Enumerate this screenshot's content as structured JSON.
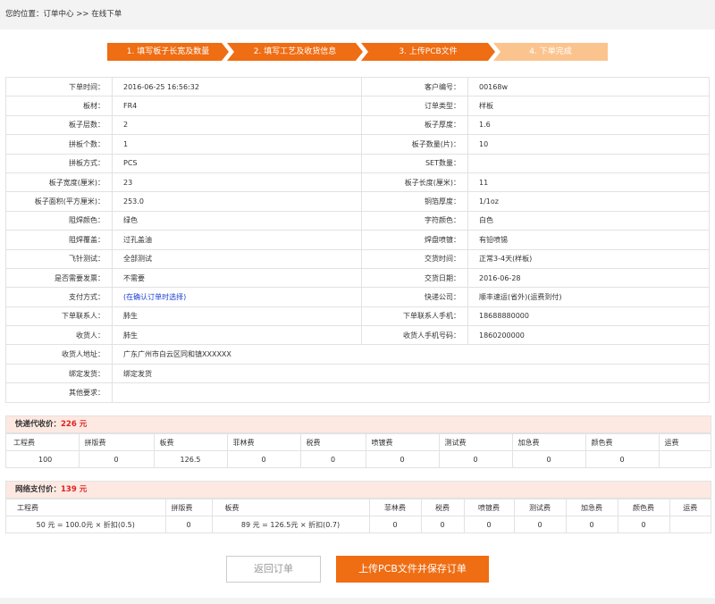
{
  "breadcrumb": {
    "prefix": "您的位置：",
    "items": [
      "订单中心",
      ">>",
      "在线下单"
    ]
  },
  "steps": [
    "1. 填写板子长宽及数量",
    "2. 填写工艺及收货信息",
    "3. 上传PCB文件",
    "4. 下单完成"
  ],
  "colors": {
    "accent": "#ef6d13",
    "accent_light": "#fbc48f",
    "price_red": "#e02020",
    "link_blue": "#1a3fd4"
  },
  "info": {
    "order_time_label": "下单时间：",
    "order_time": "2016-06-25 16:56:32",
    "customer_no_label": "客户编号：",
    "customer_no": "00168w",
    "material_label": "板材：",
    "material": "FR4",
    "order_type_label": "订单类型：",
    "order_type": "样板",
    "layers_label": "板子层数：",
    "layers": "2",
    "thickness_label": "板子厚度：",
    "thickness": "1.6",
    "panel_count_label": "拼板个数：",
    "panel_count": "1",
    "qty_label": "板子数量(片)：",
    "qty": "10",
    "panel_mode_label": "拼板方式：",
    "panel_mode": "PCS",
    "set_qty_label": "SET数量：",
    "set_qty": "",
    "width_label": "板子宽度(厘米)：",
    "width": "23",
    "length_label": "板子长度(厘米)：",
    "length": "11",
    "area_label": "板子面积(平方厘米)：",
    "area": "253.0",
    "copper_label": "铜箔厚度：",
    "copper": "1/1oz",
    "mask_color_label": "阻焊颜色：",
    "mask_color": "绿色",
    "silk_color_label": "字符颜色：",
    "silk_color": "白色",
    "mask_cover_label": "阻焊覆盖：",
    "mask_cover": "过孔盖油",
    "surface_label": "焊盘喷镀：",
    "surface": "有铅喷锡",
    "flying_label": "飞针测试：",
    "flying": "全部测试",
    "delivery_time_label": "交货时间：",
    "delivery_time": "正常3-4天(样板)",
    "invoice_label": "是否需要发票：",
    "invoice": "不需要",
    "delivery_date_label": "交货日期：",
    "delivery_date": "2016-06-28",
    "pay_label": "支付方式：",
    "pay": "(在确认订单时选择)",
    "courier_label": "快递公司：",
    "courier": "顺丰速运(省外)(运费到付)",
    "contact_label": "下单联系人：",
    "contact": "肺生",
    "contact_phone_label": "下单联系人手机：",
    "contact_phone": "18688880000",
    "receiver_label": "收货人：",
    "receiver": "肺生",
    "receiver_phone_label": "收货人手机号码：",
    "receiver_phone": "1860200000",
    "address_label": "收货人地址：",
    "address": "广东广州市白云区同和镇XXXXXX",
    "bind_label": "绑定发货：",
    "bind": "绑定发货",
    "other_label": "其他要求：",
    "other": ""
  },
  "express": {
    "title": "快递代收价：",
    "amount": "226 元",
    "headers": [
      "工程费",
      "拼版费",
      "板费",
      "菲林费",
      "税费",
      "喷镀费",
      "测试费",
      "加急费",
      "颜色费",
      "运费"
    ],
    "values": [
      "100",
      "0",
      "126.5",
      "0",
      "0",
      "0",
      "0",
      "0",
      "0",
      ""
    ]
  },
  "online": {
    "title": "网络支付价：",
    "amount": "139 元",
    "headers": [
      "工程费",
      "拼版费",
      "板费",
      "菲林费",
      "税费",
      "喷镀费",
      "测试费",
      "加急费",
      "颜色费",
      "运费"
    ],
    "values": [
      "50 元 = 100.0元 × 折扣(0.5)",
      "0",
      "89 元 = 126.5元 × 折扣(0.7)",
      "0",
      "0",
      "0",
      "0",
      "0",
      "0",
      ""
    ]
  },
  "buttons": {
    "back": "返回订单",
    "save": "上传PCB文件并保存订单"
  }
}
